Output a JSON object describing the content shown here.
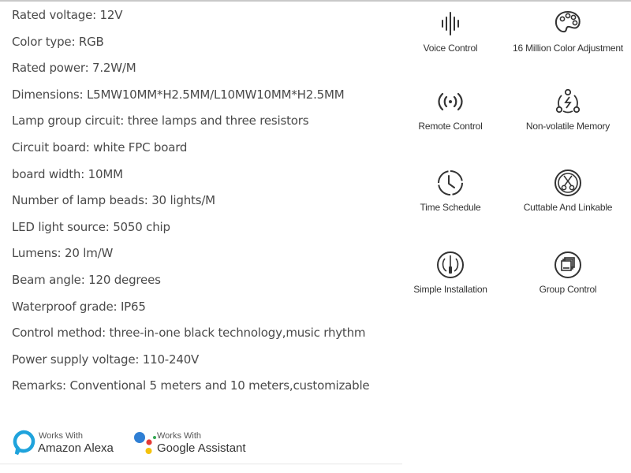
{
  "specs": [
    "Rated voltage: 12V",
    "Color type: RGB",
    "Rated power: 7.2W/M",
    "Dimensions: L5MW10MM*H2.5MM/L10MW10MM*H2.5MM",
    "Lamp group circuit: three lamps and three resistors",
    "Circuit board: white FPC board",
    "board width: 10MM",
    "Number of lamp beads: 30 lights/M",
    "LED light source: 5050 chip",
    "Lumens: 20 lm/W",
    "Beam angle: 120 degrees",
    "Waterproof grade: IP65",
    "Control method: three-in-one black technology,music rhythm",
    "Power supply voltage: 110-240V",
    "Remarks: Conventional 5 meters and 10 meters,customizable"
  ],
  "features": [
    {
      "label": "Voice Control",
      "icon": "sound-wave-icon"
    },
    {
      "label": "16 Million Color Adjustment",
      "icon": "palette-icon"
    },
    {
      "label": "Remote Control",
      "icon": "wireless-signal-icon"
    },
    {
      "label": "Non-volatile Memory",
      "icon": "power-cycle-icon"
    },
    {
      "label": "Time Schedule",
      "icon": "clock-icon"
    },
    {
      "label": "Cuttable And Linkable",
      "icon": "scissors-icon"
    },
    {
      "label": "Simple Installation",
      "icon": "screwdriver-icon"
    },
    {
      "label": "Group Control",
      "icon": "stacked-windows-icon"
    }
  ],
  "badges": {
    "alexa": {
      "small": "Works With",
      "big": "Amazon Alexa",
      "color": "#1fa3dc"
    },
    "google": {
      "small": "Works With",
      "big": "Google Assistant",
      "colors": [
        "#2f7fd4",
        "#e53935",
        "#f4c20d",
        "#34a853"
      ]
    }
  }
}
